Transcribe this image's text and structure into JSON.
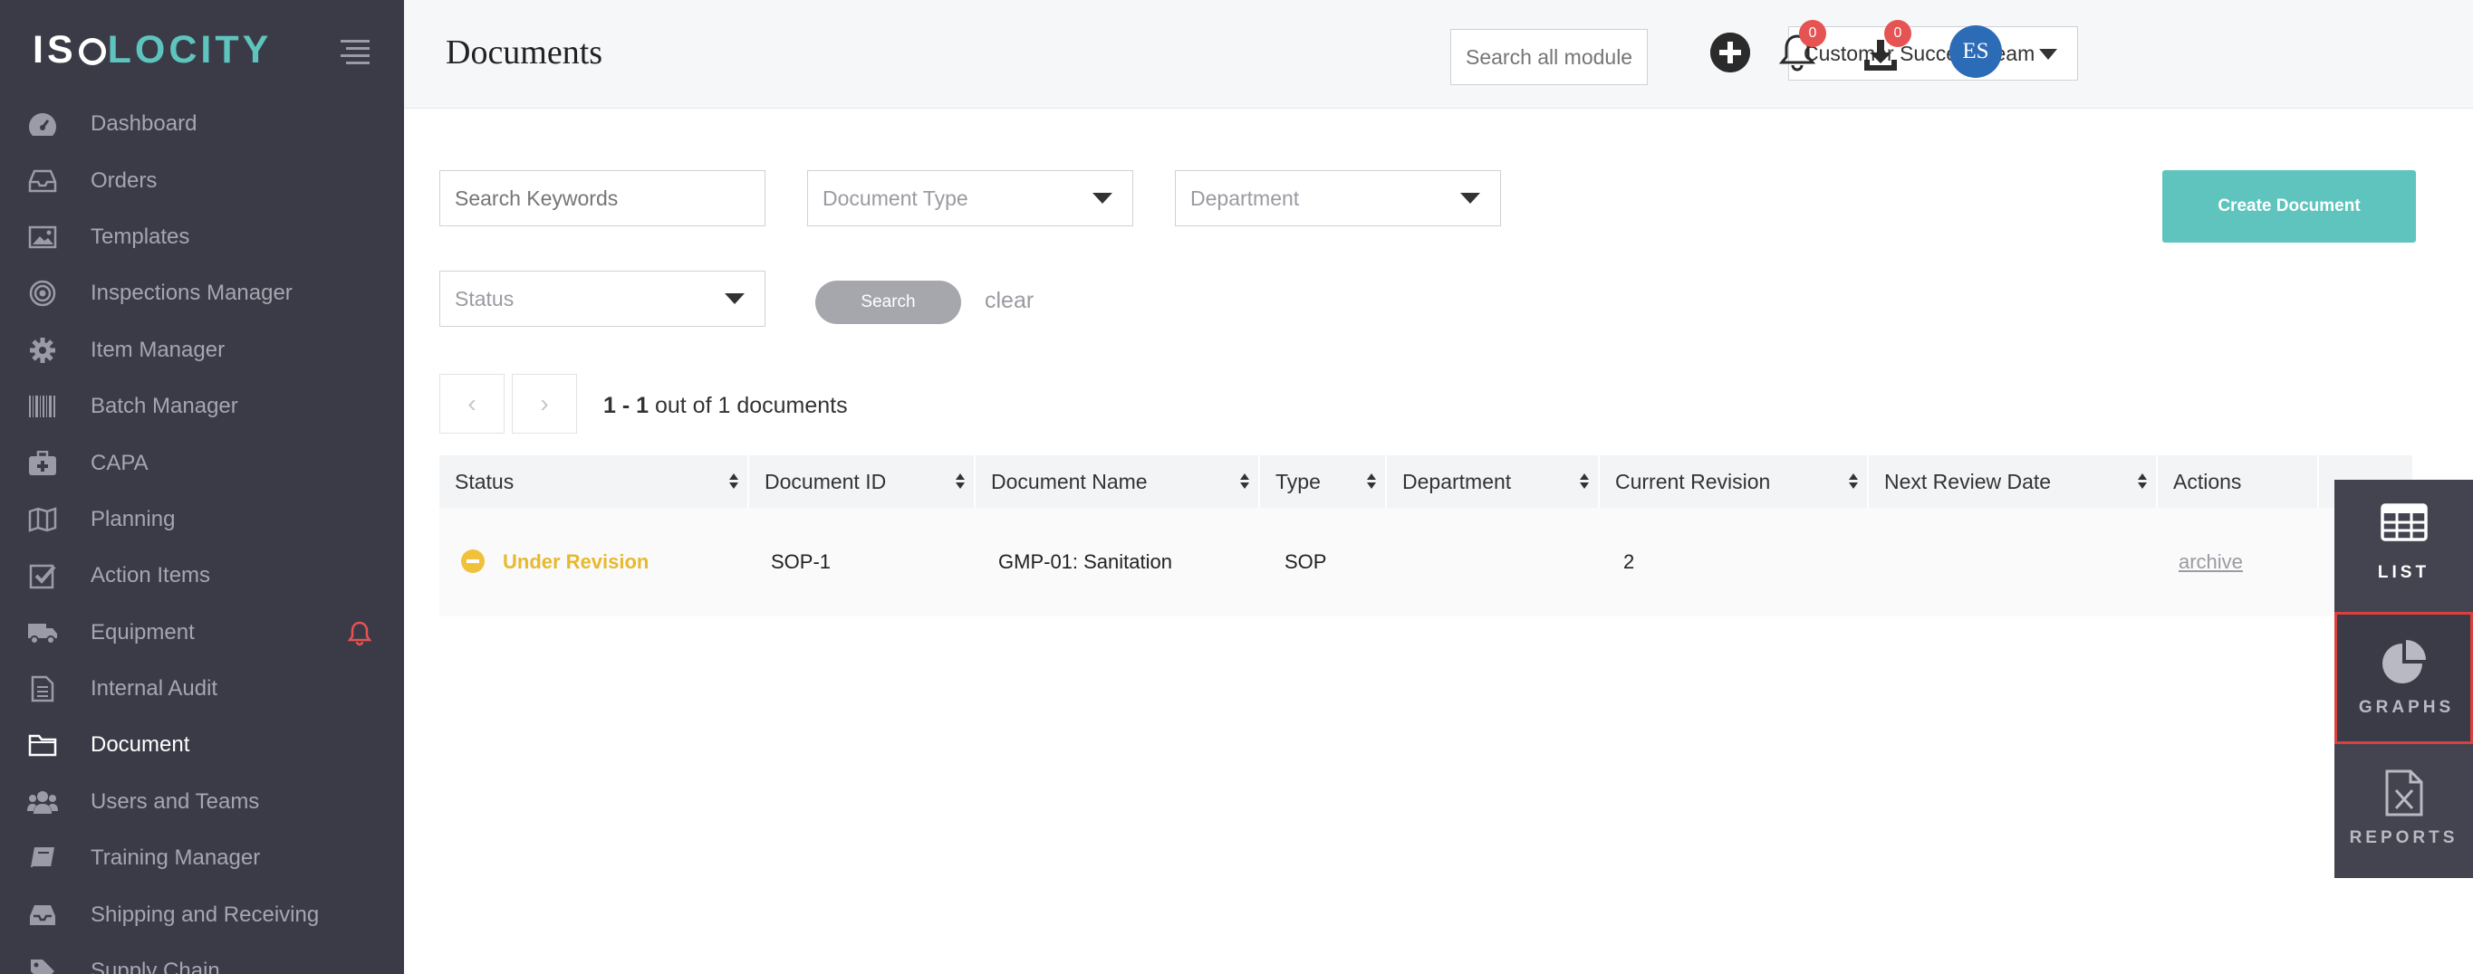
{
  "app": {
    "logo_left": "IS",
    "logo_right": "LOCITY"
  },
  "sidebar": {
    "items": [
      {
        "label": "Dashboard",
        "icon": "dashboard-icon"
      },
      {
        "label": "Orders",
        "icon": "inbox-icon"
      },
      {
        "label": "Templates",
        "icon": "image-icon"
      },
      {
        "label": "Inspections Manager",
        "icon": "target-icon"
      },
      {
        "label": "Item Manager",
        "icon": "gear-icon"
      },
      {
        "label": "Batch Manager",
        "icon": "barcode-icon"
      },
      {
        "label": "CAPA",
        "icon": "medkit-icon"
      },
      {
        "label": "Planning",
        "icon": "map-icon"
      },
      {
        "label": "Action Items",
        "icon": "checkbox-icon"
      },
      {
        "label": "Equipment",
        "icon": "truck-icon"
      },
      {
        "label": "Internal Audit",
        "icon": "file-icon"
      },
      {
        "label": "Document",
        "icon": "folder-icon"
      },
      {
        "label": "Users and Teams",
        "icon": "users-icon"
      },
      {
        "label": "Training Manager",
        "icon": "book-icon"
      },
      {
        "label": "Shipping and Receiving",
        "icon": "tray-icon"
      },
      {
        "label": "Supply Chain",
        "icon": "tag-icon"
      }
    ],
    "active": "Document"
  },
  "header": {
    "title": "Documents",
    "search_placeholder": "Search all modules",
    "team": "Customer Success Team",
    "notifications_count": "0",
    "downloads_count": "0",
    "avatar_initials": "ES"
  },
  "filters": {
    "keywords_placeholder": "Search Keywords",
    "document_type": "Document Type",
    "department": "Department",
    "status": "Status",
    "search_label": "Search",
    "clear_label": "clear",
    "create_label": "Create Document"
  },
  "pagination": {
    "range": "1 - 1",
    "suffix": " out of 1 documents",
    "prev": "‹",
    "next": "›"
  },
  "table": {
    "columns": [
      "Status",
      "Document ID",
      "Document Name",
      "Type",
      "Department",
      "Current Revision",
      "Next Review Date",
      "Actions"
    ],
    "rows": [
      {
        "status": "Under Revision",
        "doc_id": "SOP-1",
        "name": "GMP-01: Sanitation",
        "type": "SOP",
        "department": "",
        "revision": "2",
        "next_review": "",
        "action": "archive"
      }
    ]
  },
  "side_panel": {
    "list": "LIST",
    "graphs": "GRAPHS",
    "reports": "REPORTS"
  },
  "colors": {
    "sidebar_bg": "#3a3b47",
    "accent_teal": "#5ec4bd",
    "status_yellow": "#e6b92f",
    "badge_red": "#e55353",
    "avatar_blue": "#2c6bb5"
  }
}
